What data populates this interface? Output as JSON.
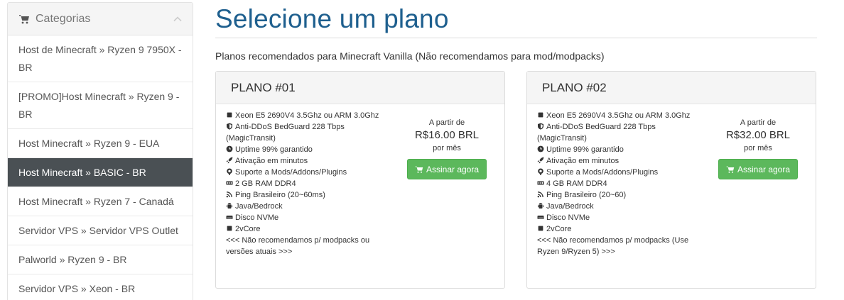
{
  "sidebar": {
    "title": "Categorias",
    "items": [
      {
        "label": "Host de Minecraft » Ryzen 9 7950X - BR"
      },
      {
        "label": "[PROMO]Host Minecraft » Ryzen 9 - BR"
      },
      {
        "label": "Host Minecraft » Ryzen 9 - EUA"
      },
      {
        "label": "Host Minecraft » BASIC - BR"
      },
      {
        "label": "Host Minecraft » Ryzen 7 - Canadá"
      },
      {
        "label": "Servidor VPS » Servidor VPS Outlet"
      },
      {
        "label": "Palworld » Ryzen 9 - BR"
      },
      {
        "label": "Servidor VPS » Xeon - BR"
      }
    ],
    "active_index": 3
  },
  "main": {
    "title": "Selecione um plano",
    "subtitle": "Planos recomendados para Minecraft Vanilla (Não recomendamos para mod/modpacks)"
  },
  "plans": [
    {
      "name": "PLANO #01",
      "features": [
        "Xeon E5 2690V4 3.5Ghz ou ARM 3.0Ghz",
        "Anti-DDoS BedGuard 228 Tbps (MagicTransit)",
        "Uptime 99% garantido",
        "Ativação em minutos",
        "Suporte a Mods/Addons/Plugins",
        "2 GB RAM DDR4",
        "Ping Brasileiro (20~60ms)",
        "Java/Bedrock",
        "Disco NVMe",
        "2vCore",
        "<<< Não recomendamos p/ modpacks ou versões atuais >>>"
      ],
      "from_label": "A partir de",
      "price": "R$16.00 BRL",
      "period": "por mês",
      "button_label": "Assinar agora"
    },
    {
      "name": "PLANO #02",
      "features": [
        "Xeon E5 2690V4 3.5Ghz ou ARM 3.0Ghz",
        "Anti-DDoS BedGuard 228 Tbps (MagicTransit)",
        "Uptime 99% garantido",
        "Ativação em minutos",
        "Suporte a Mods/Addons/Plugins",
        "4 GB RAM DDR4",
        "Ping Brasileiro (20~60)",
        "Java/Bedrock",
        "Disco NVMe",
        "2vCore",
        "<<< Não recomendamos p/ modpacks (Use Ryzen 9/Ryzen 5) >>>"
      ],
      "from_label": "A partir de",
      "price": "R$32.00 BRL",
      "period": "por mês",
      "button_label": "Assinar agora"
    }
  ],
  "icons": {
    "features": [
      "cpu-icon",
      "shield-icon",
      "clock-icon",
      "rocket-icon",
      "support-icon",
      "memory-icon",
      "signal-icon",
      "android-icon",
      "drive-icon",
      "cpu-icon",
      ""
    ]
  },
  "colors": {
    "title": "#1e5f8e",
    "active_item_bg": "#4a5054",
    "button_bg": "#5cb85c"
  }
}
